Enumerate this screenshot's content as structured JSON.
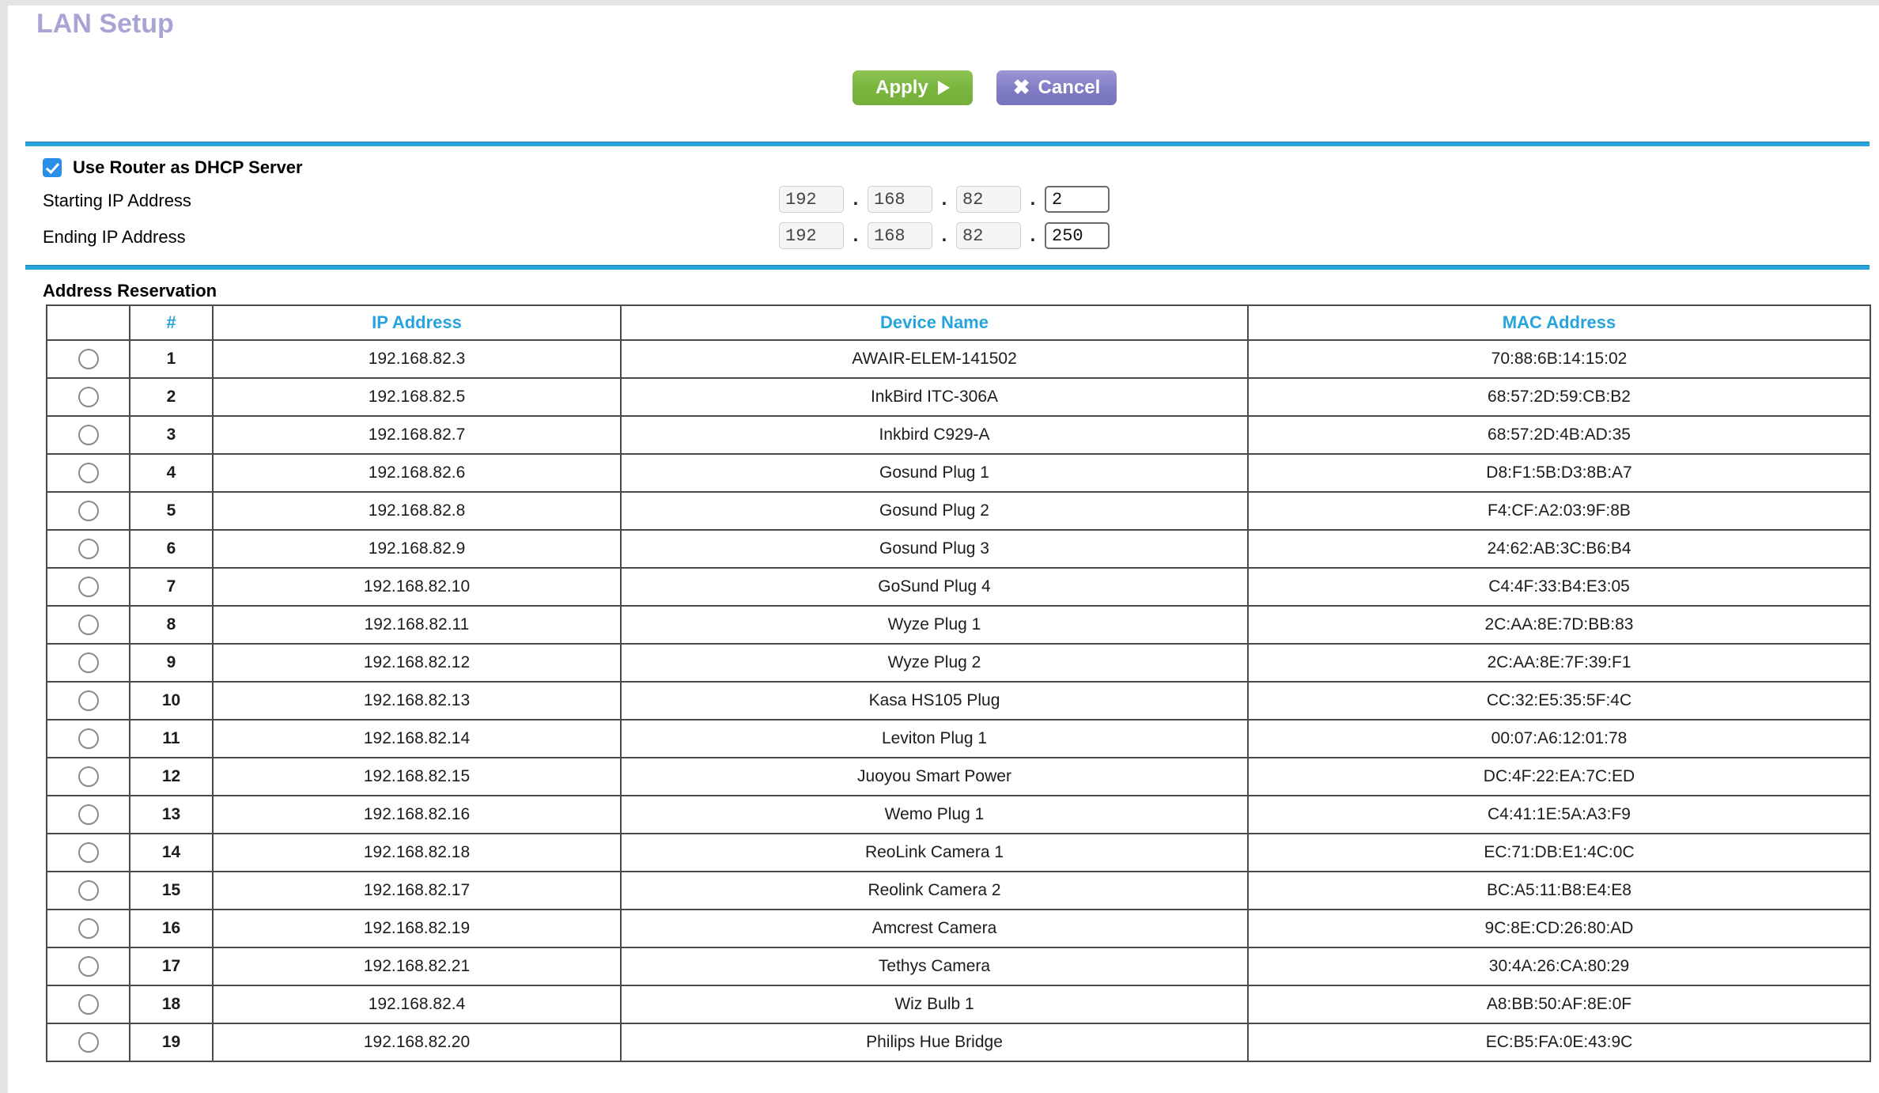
{
  "page": {
    "title": "LAN Setup"
  },
  "toolbar": {
    "apply_label": "Apply",
    "cancel_label": "Cancel",
    "apply_color": "#7ab63e",
    "cancel_color": "#807cc4"
  },
  "dhcp": {
    "use_router_label": "Use Router as DHCP Server",
    "use_router_checked": true,
    "starting_label": "Starting IP Address",
    "ending_label": "Ending IP Address",
    "starting_ip": [
      "192",
      "168",
      "82",
      "2"
    ],
    "ending_ip": [
      "192",
      "168",
      "82",
      "250"
    ],
    "separator": "."
  },
  "reservation": {
    "section_title": "Address Reservation",
    "headers": {
      "select": "",
      "number": "#",
      "ip": "IP Address",
      "device": "Device Name",
      "mac": "MAC Address"
    },
    "header_color": "#27a3dd",
    "rows": [
      {
        "num": "1",
        "ip": "192.168.82.3",
        "device": "AWAIR-ELEM-141502",
        "mac": "70:88:6B:14:15:02"
      },
      {
        "num": "2",
        "ip": "192.168.82.5",
        "device": "InkBird ITC-306A",
        "mac": "68:57:2D:59:CB:B2"
      },
      {
        "num": "3",
        "ip": "192.168.82.7",
        "device": "Inkbird C929-A",
        "mac": "68:57:2D:4B:AD:35"
      },
      {
        "num": "4",
        "ip": "192.168.82.6",
        "device": "Gosund Plug 1",
        "mac": "D8:F1:5B:D3:8B:A7"
      },
      {
        "num": "5",
        "ip": "192.168.82.8",
        "device": "Gosund Plug 2",
        "mac": "F4:CF:A2:03:9F:8B"
      },
      {
        "num": "6",
        "ip": "192.168.82.9",
        "device": "Gosund Plug 3",
        "mac": "24:62:AB:3C:B6:B4"
      },
      {
        "num": "7",
        "ip": "192.168.82.10",
        "device": "GoSund Plug 4",
        "mac": "C4:4F:33:B4:E3:05"
      },
      {
        "num": "8",
        "ip": "192.168.82.11",
        "device": "Wyze Plug 1",
        "mac": "2C:AA:8E:7D:BB:83"
      },
      {
        "num": "9",
        "ip": "192.168.82.12",
        "device": "Wyze Plug 2",
        "mac": "2C:AA:8E:7F:39:F1"
      },
      {
        "num": "10",
        "ip": "192.168.82.13",
        "device": "Kasa HS105 Plug",
        "mac": "CC:32:E5:35:5F:4C"
      },
      {
        "num": "11",
        "ip": "192.168.82.14",
        "device": "Leviton Plug 1",
        "mac": "00:07:A6:12:01:78"
      },
      {
        "num": "12",
        "ip": "192.168.82.15",
        "device": "Juoyou Smart Power",
        "mac": "DC:4F:22:EA:7C:ED"
      },
      {
        "num": "13",
        "ip": "192.168.82.16",
        "device": "Wemo Plug 1",
        "mac": "C4:41:1E:5A:A3:F9"
      },
      {
        "num": "14",
        "ip": "192.168.82.18",
        "device": "ReoLink Camera 1",
        "mac": "EC:71:DB:E1:4C:0C"
      },
      {
        "num": "15",
        "ip": "192.168.82.17",
        "device": "Reolink Camera 2",
        "mac": "BC:A5:11:B8:E4:E8"
      },
      {
        "num": "16",
        "ip": "192.168.82.19",
        "device": "Amcrest Camera",
        "mac": "9C:8E:CD:26:80:AD"
      },
      {
        "num": "17",
        "ip": "192.168.82.21",
        "device": "Tethys Camera",
        "mac": "30:4A:26:CA:80:29"
      },
      {
        "num": "18",
        "ip": "192.168.82.4",
        "device": "Wiz Bulb 1",
        "mac": "A8:BB:50:AF:8E:0F"
      },
      {
        "num": "19",
        "ip": "192.168.82.20",
        "device": "Philips Hue Bridge",
        "mac": "EC:B5:FA:0E:43:9C"
      }
    ]
  }
}
